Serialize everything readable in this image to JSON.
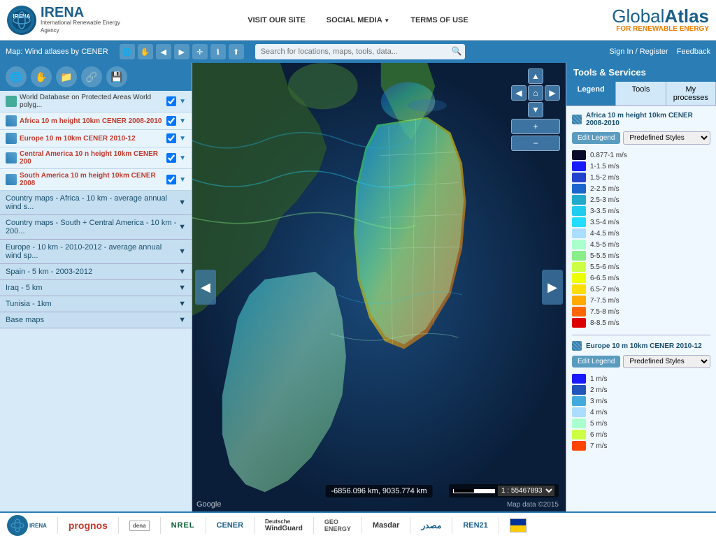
{
  "header": {
    "irena_name": "IRENA",
    "irena_full": "International Renewable Energy Agency",
    "nav": {
      "visit": "VISIT OUR SITE",
      "social": "SOCIAL MEDIA",
      "terms": "TERMS OF USE"
    },
    "global_atlas": "Global Atlas",
    "global_atlas_sub": "FOR RENEWABLE ENERGY",
    "sign_in": "Sign In / Register",
    "feedback": "Feedback"
  },
  "toolbar": {
    "map_label": "Map: Wind atlases by CENER",
    "search_placeholder": "Search for locations, maps, tools, data..."
  },
  "sidebar": {
    "layers": [
      {
        "id": "protected",
        "text": "World Database on Protected Areas World polyg...",
        "type": "protect",
        "active": false,
        "checked": true
      },
      {
        "id": "africa",
        "text": "Africa 10 m height 10km CENER 2008-2010",
        "type": "wind",
        "active": true,
        "checked": true
      },
      {
        "id": "europe",
        "text": "Europe 10 m 10km CENER 2010-12",
        "type": "wind",
        "active": true,
        "checked": true
      },
      {
        "id": "central",
        "text": "Central America 10 n height 10km CENER 200",
        "type": "wind",
        "active": true,
        "checked": true
      },
      {
        "id": "south",
        "text": "South America 10 m height 10km CENER 2008",
        "type": "wind",
        "active": true,
        "checked": true
      }
    ],
    "sections": [
      {
        "id": "country-africa",
        "label": "Country maps - Africa - 10 km - average annual wind s..."
      },
      {
        "id": "country-south",
        "label": "Country maps - South + Central America - 10 km - 200..."
      },
      {
        "id": "europe-section",
        "label": "Europe - 10 km - 2010-2012 - average annual wind sp..."
      },
      {
        "id": "spain",
        "label": "Spain - 5 km - 2003-2012"
      },
      {
        "id": "iraq",
        "label": "Iraq - 5 km"
      },
      {
        "id": "tunisia",
        "label": "Tunisia - 1km"
      },
      {
        "id": "base-maps",
        "label": "Base maps"
      }
    ]
  },
  "tools_panel": {
    "title": "Tools & Services",
    "tabs": [
      "Legend",
      "Tools",
      "My processes"
    ],
    "active_tab": 0,
    "legend_sections": [
      {
        "id": "africa-legend",
        "title": "Africa 10 m height 10km CENER 2008-2010",
        "edit_label": "Edit Legend",
        "style_placeholder": "Predefined Styles",
        "colors": [
          {
            "color": "#0a0a2a",
            "label": "0.877-1 m/s"
          },
          {
            "color": "#1a1aff",
            "label": "1-1.5 m/s"
          },
          {
            "color": "#2244cc",
            "label": "1.5-2 m/s"
          },
          {
            "color": "#2266aa",
            "label": "2-2.5 m/s"
          },
          {
            "color": "#22aacc",
            "label": "2.5-3 m/s"
          },
          {
            "color": "#22ccee",
            "label": "3-3.5 m/s"
          },
          {
            "color": "#22ddff",
            "label": "3.5-4 m/s"
          },
          {
            "color": "#aaddff",
            "label": "4-4.5 m/s"
          },
          {
            "color": "#aaffcc",
            "label": "4.5-5 m/s"
          },
          {
            "color": "#88ee88",
            "label": "5-5.5 m/s"
          },
          {
            "color": "#ccff44",
            "label": "5.5-6 m/s"
          },
          {
            "color": "#eeff00",
            "label": "6-6.5 m/s"
          },
          {
            "color": "#ffdd00",
            "label": "6.5-7 m/s"
          },
          {
            "color": "#ffaa00",
            "label": "7-7.5 m/s"
          },
          {
            "color": "#ff6600",
            "label": "7.5-8 m/s"
          },
          {
            "color": "#dd0000",
            "label": "8-8.5 m/s"
          }
        ]
      },
      {
        "id": "europe-legend",
        "title": "Europe 10 m 10km CENER 2010-12",
        "edit_label": "Edit Legend",
        "style_placeholder": "Predefined Styles",
        "colors": [
          {
            "color": "#1a1aff",
            "label": "1 m/s"
          },
          {
            "color": "#2255bb",
            "label": "2 m/s"
          },
          {
            "color": "#44aadd",
            "label": "3 m/s"
          },
          {
            "color": "#aaddff",
            "label": "4 m/s"
          },
          {
            "color": "#aaffcc",
            "label": "5 m/s"
          },
          {
            "color": "#ccff44",
            "label": "6 m/s"
          },
          {
            "color": "#ff4400",
            "label": "7 m/s"
          }
        ]
      }
    ]
  },
  "map": {
    "coords": "-6856.096 km, 9035.774 km",
    "scale": "1 : 55467893",
    "data_label": "Map data ©2015",
    "google_label": "Google"
  },
  "footer": {
    "logos": [
      "IRENA",
      "prognos",
      "",
      "NREL",
      "CENER",
      "WindGuard",
      "GEOENERGY",
      "Masdar",
      "مصدر",
      "REN21"
    ]
  }
}
